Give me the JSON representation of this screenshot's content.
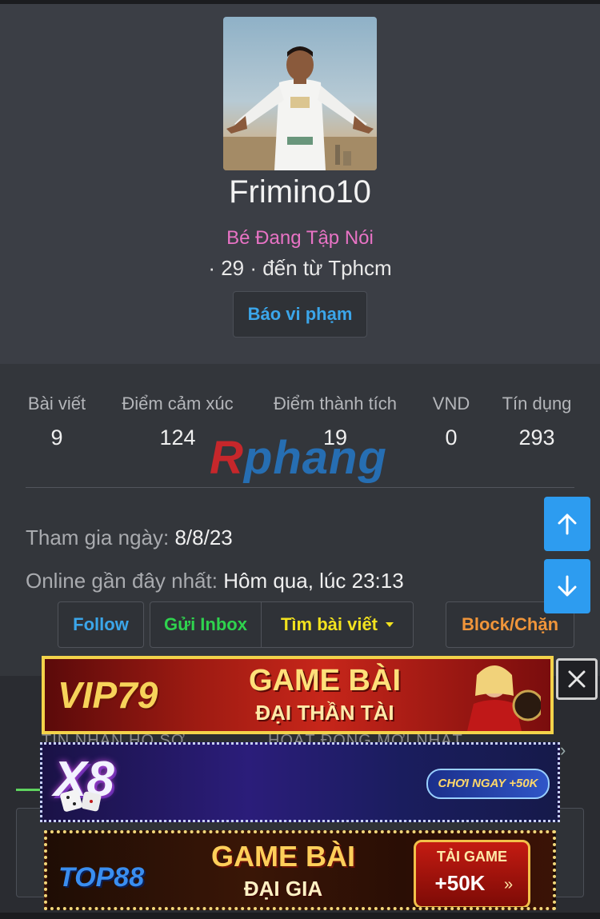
{
  "profile": {
    "username": "Frimino10",
    "user_title": "Bé Đang Tập Nói",
    "meta": "· 29 · đến từ Tphcm",
    "report_label": "Báo vi phạm"
  },
  "stats": [
    {
      "label": "Bài viết",
      "value": "9"
    },
    {
      "label": "Điểm cảm xúc",
      "value": "124"
    },
    {
      "label": "Điểm thành tích",
      "value": "19"
    },
    {
      "label": "VND",
      "value": "0"
    },
    {
      "label": "Tín dụng",
      "value": "293"
    }
  ],
  "watermark": {
    "prefix": "R",
    "rest": "phang"
  },
  "info": {
    "joined_label": "Tham gia ngày:",
    "joined_value": "8/8/23",
    "online_label": "Online gần đây nhất:",
    "online_value": "Hôm qua, lúc 23:13"
  },
  "actions": {
    "follow": "Follow",
    "inbox": "Gửi Inbox",
    "find_posts": "Tìm bài viết",
    "block": "Block/Chặn"
  },
  "tabs": {
    "tab1": "TIN NHẮN HỒ SƠ",
    "tab2": "HOẠT ĐỘNG MỚI NHẤT"
  },
  "ads": {
    "vip79": {
      "logo": "VIP79",
      "line1": "GAME BÀI",
      "line2": "ĐẠI THẦN TÀI"
    },
    "x8": {
      "logo": "X8",
      "cta": "CHƠI NGAY +50K"
    },
    "top88": {
      "logo": "TOP88",
      "line1": "GAME BÀI",
      "line2": "ĐẠI GIA",
      "cta1": "TẢI GAME",
      "cta2": "+50K"
    }
  },
  "colors": {
    "accent_blue": "#3ba6ea",
    "title_pink": "#e873c5",
    "inbox_green": "#2fd34e",
    "find_yellow": "#f2e21e",
    "block_orange": "#f0953a",
    "scroll_btn": "#2d9cf0"
  },
  "icons": {
    "scroll_up": "arrow-up-icon",
    "scroll_down": "arrow-down-icon",
    "close_ad": "close-icon",
    "dropdown": "caret-down-icon"
  }
}
